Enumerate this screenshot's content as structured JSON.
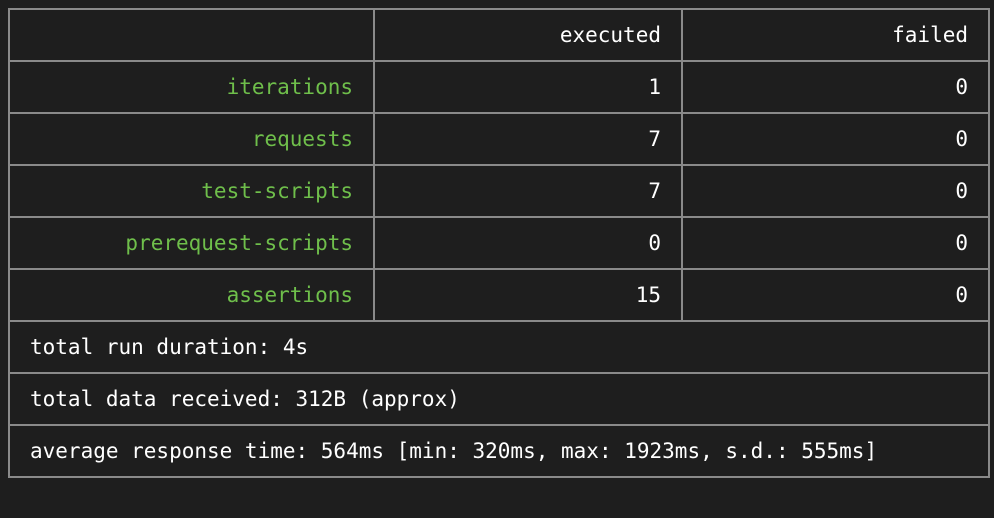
{
  "header": {
    "blank": "",
    "executed": "executed",
    "failed": "failed"
  },
  "rows": [
    {
      "label": "iterations",
      "executed": "1",
      "failed": "0"
    },
    {
      "label": "requests",
      "executed": "7",
      "failed": "0"
    },
    {
      "label": "test-scripts",
      "executed": "7",
      "failed": "0"
    },
    {
      "label": "prerequest-scripts",
      "executed": "0",
      "failed": "0"
    },
    {
      "label": "assertions",
      "executed": "15",
      "failed": "0"
    }
  ],
  "footer": {
    "duration": "total run duration: 4s",
    "data_received": "total data received: 312B (approx)",
    "response_time": "average response time: 564ms [min: 320ms, max: 1923ms, s.d.: 555ms]"
  },
  "colors": {
    "background": "#1e1e1e",
    "border": "#8a8a8a",
    "label_green": "#6fbf4b",
    "text": "#ffffff"
  }
}
